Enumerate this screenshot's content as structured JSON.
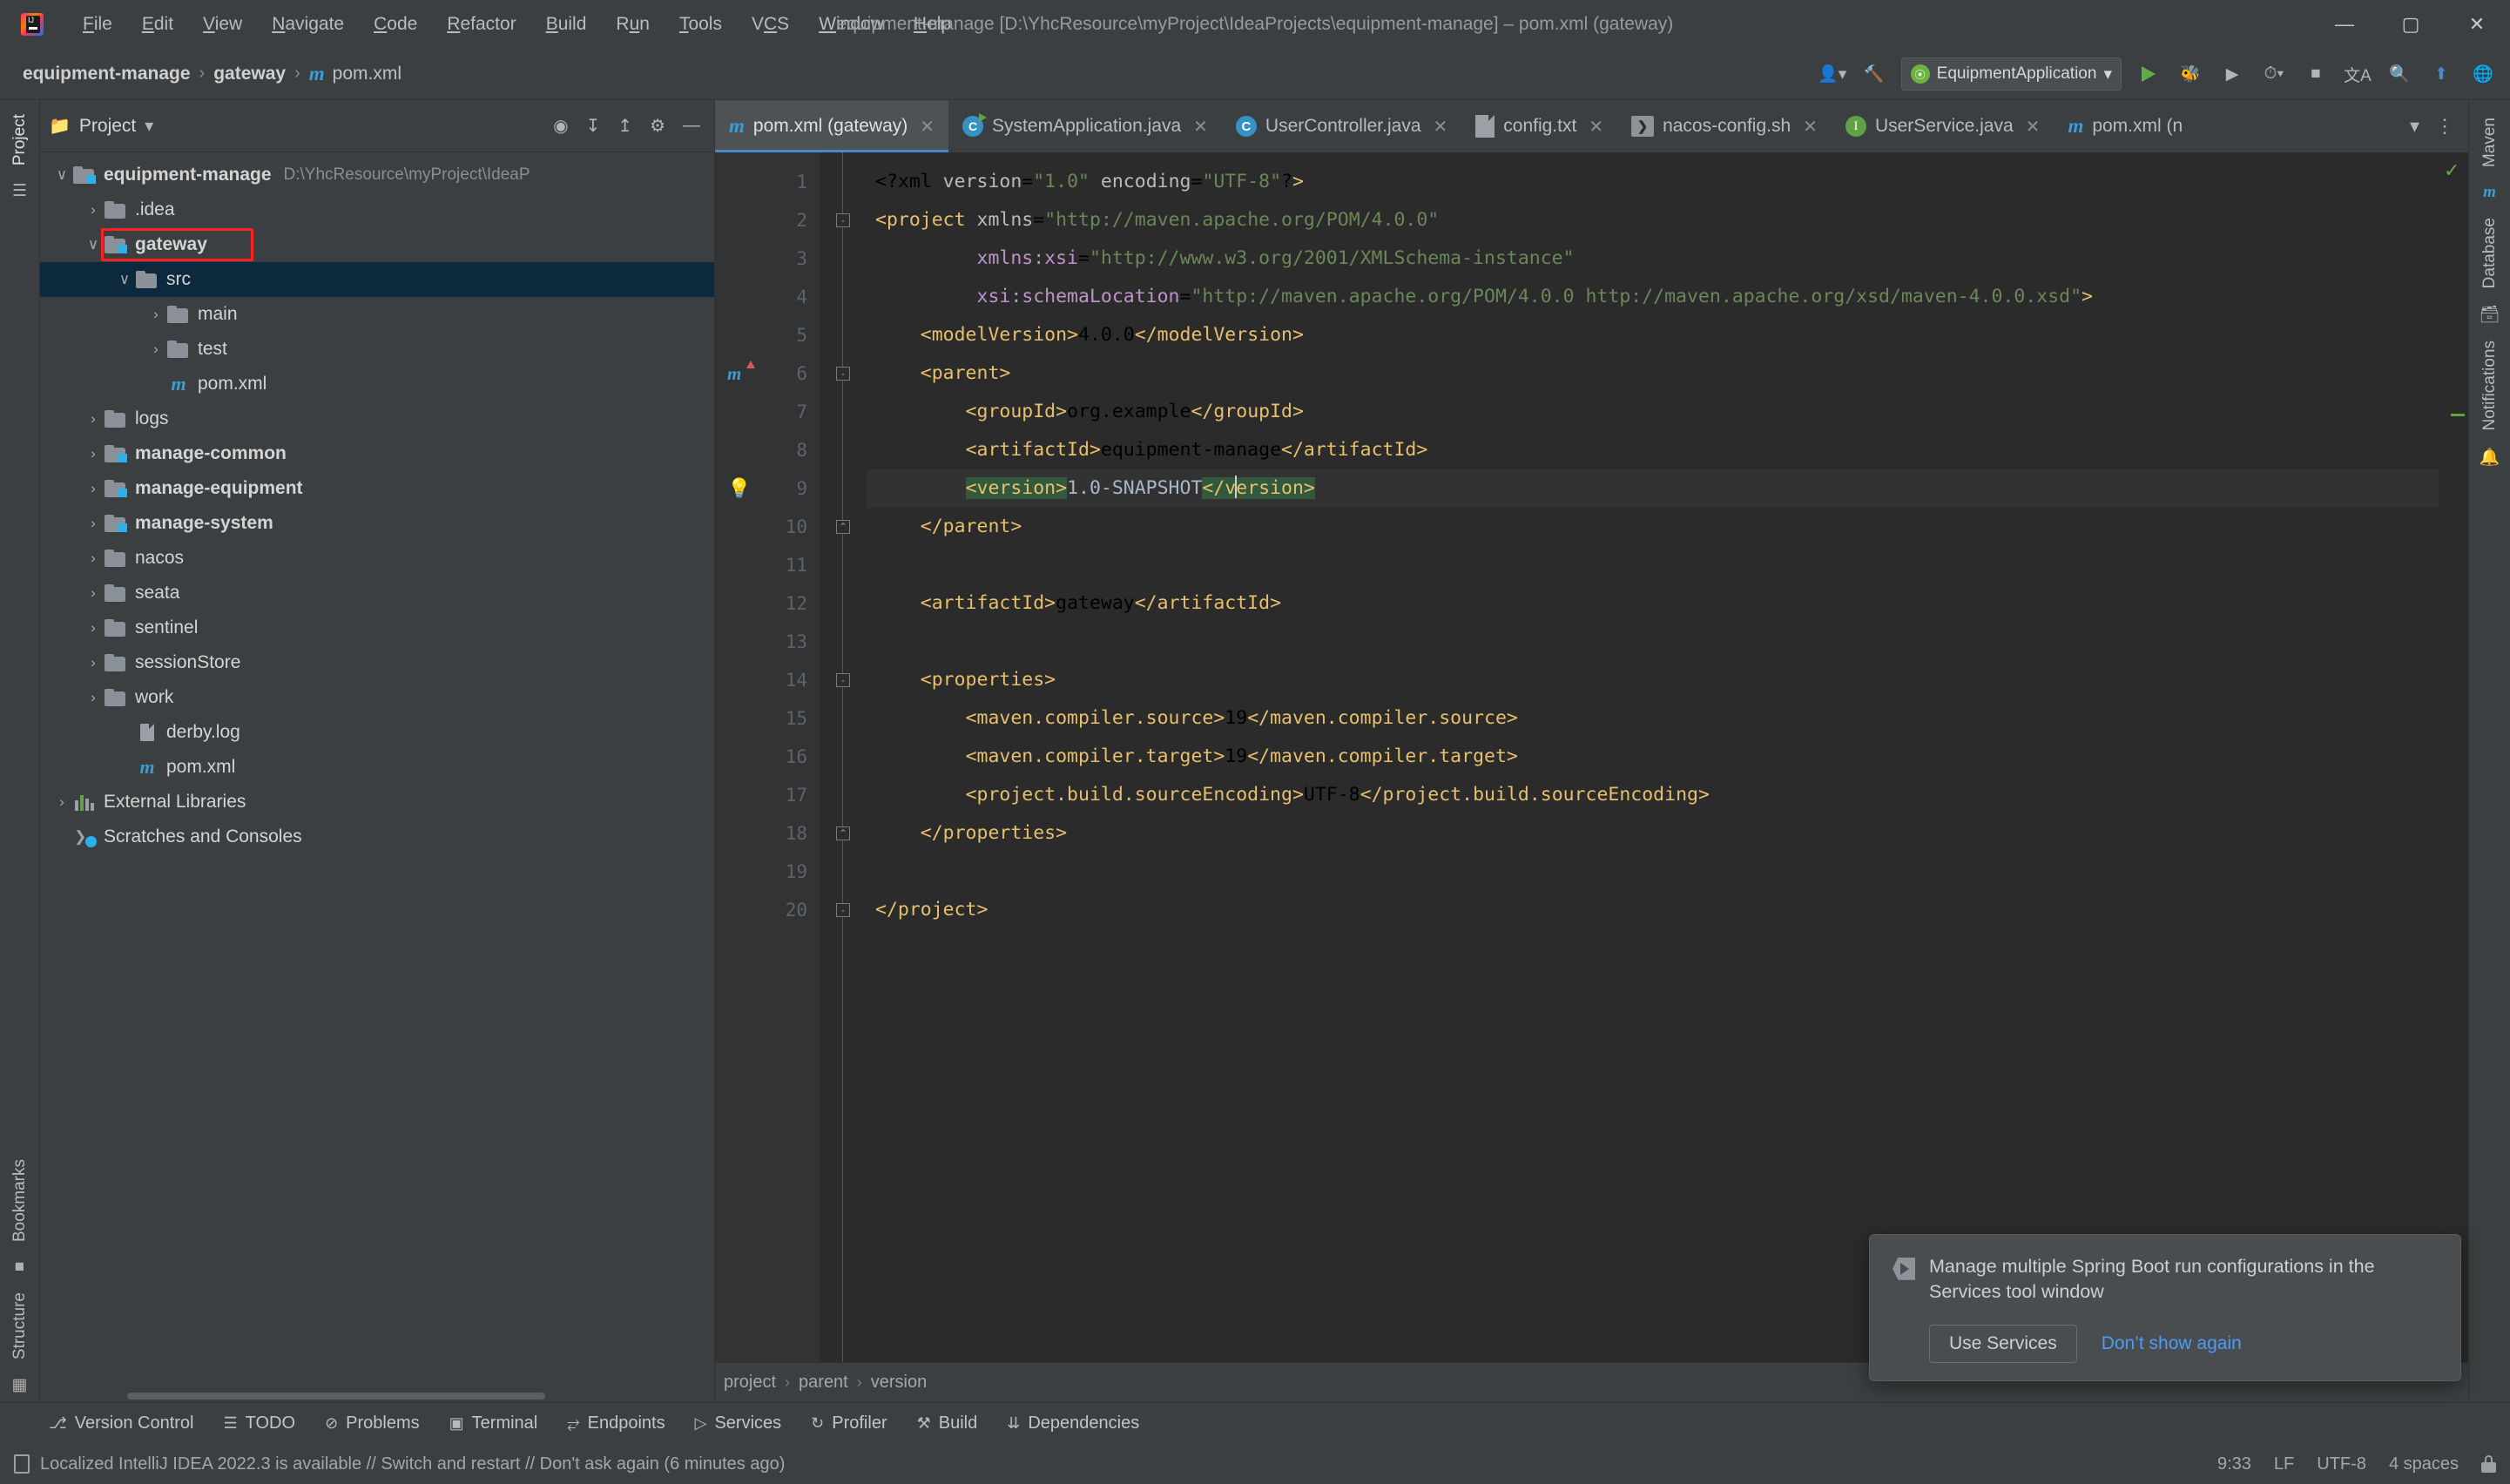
{
  "window": {
    "title": "equipment-manage [D:\\YhcResource\\myProject\\IdeaProjects\\equipment-manage] – pom.xml (gateway)",
    "minimize": "—",
    "maximize": "▢",
    "close": "✕"
  },
  "menubar": [
    {
      "label": "File",
      "mnemonic": "F"
    },
    {
      "label": "Edit",
      "mnemonic": "E"
    },
    {
      "label": "View",
      "mnemonic": "V"
    },
    {
      "label": "Navigate",
      "mnemonic": "N"
    },
    {
      "label": "Code",
      "mnemonic": "C"
    },
    {
      "label": "Refactor",
      "mnemonic": "R"
    },
    {
      "label": "Build",
      "mnemonic": "B"
    },
    {
      "label": "Run",
      "mnemonic": "u"
    },
    {
      "label": "Tools",
      "mnemonic": "T"
    },
    {
      "label": "VCS",
      "mnemonic": "S"
    },
    {
      "label": "Window",
      "mnemonic": "W"
    },
    {
      "label": "Help",
      "mnemonic": "H"
    }
  ],
  "navbar": {
    "breadcrumbs": [
      "equipment-manage",
      "gateway",
      "pom.xml"
    ],
    "separator": "›",
    "run_configuration": "EquipmentApplication",
    "run_config_caret": "▾"
  },
  "project_panel": {
    "title": "Project",
    "caret": "▾",
    "icons": [
      "locate-icon",
      "expand-all-icon",
      "collapse-all-icon",
      "settings-icon",
      "hide-icon"
    ],
    "tree": [
      {
        "label": "equipment-manage",
        "sub": "D:\\YhcResource\\myProject\\IdeaP",
        "depth": 0,
        "arrow": "∨",
        "kind": "module",
        "bold": true,
        "selected": false
      },
      {
        "label": ".idea",
        "depth": 1,
        "arrow": "›",
        "kind": "folder",
        "bold": false,
        "selected": false
      },
      {
        "label": "gateway",
        "depth": 1,
        "arrow": "∨",
        "kind": "module",
        "bold": true,
        "selected": false,
        "highlighted": true
      },
      {
        "label": "src",
        "depth": 2,
        "arrow": "∨",
        "kind": "folder",
        "bold": false,
        "selected": true
      },
      {
        "label": "main",
        "depth": 3,
        "arrow": "›",
        "kind": "folder",
        "bold": false,
        "selected": false
      },
      {
        "label": "test",
        "depth": 3,
        "arrow": "›",
        "kind": "folder",
        "bold": false,
        "selected": false
      },
      {
        "label": "pom.xml",
        "depth": 3,
        "arrow": "",
        "kind": "maven",
        "bold": false,
        "selected": false
      },
      {
        "label": "logs",
        "depth": 1,
        "arrow": "›",
        "kind": "folder",
        "bold": false,
        "selected": false
      },
      {
        "label": "manage-common",
        "depth": 1,
        "arrow": "›",
        "kind": "module",
        "bold": true,
        "selected": false
      },
      {
        "label": "manage-equipment",
        "depth": 1,
        "arrow": "›",
        "kind": "module",
        "bold": true,
        "selected": false
      },
      {
        "label": "manage-system",
        "depth": 1,
        "arrow": "›",
        "kind": "module",
        "bold": true,
        "selected": false
      },
      {
        "label": "nacos",
        "depth": 1,
        "arrow": "›",
        "kind": "folder",
        "bold": false,
        "selected": false
      },
      {
        "label": "seata",
        "depth": 1,
        "arrow": "›",
        "kind": "folder",
        "bold": false,
        "selected": false
      },
      {
        "label": "sentinel",
        "depth": 1,
        "arrow": "›",
        "kind": "folder",
        "bold": false,
        "selected": false
      },
      {
        "label": "sessionStore",
        "depth": 1,
        "arrow": "›",
        "kind": "folder",
        "bold": false,
        "selected": false
      },
      {
        "label": "work",
        "depth": 1,
        "arrow": "›",
        "kind": "folder",
        "bold": false,
        "selected": false
      },
      {
        "label": "derby.log",
        "depth": 2,
        "arrow": "",
        "kind": "doc",
        "bold": false,
        "selected": false
      },
      {
        "label": "pom.xml",
        "depth": 2,
        "arrow": "",
        "kind": "maven",
        "bold": false,
        "selected": false
      },
      {
        "label": "External Libraries",
        "depth": 0,
        "arrow": "›",
        "kind": "library",
        "bold": false,
        "selected": false
      },
      {
        "label": "Scratches and Consoles",
        "depth": 0,
        "arrow": "",
        "kind": "scratch",
        "bold": false,
        "selected": false
      }
    ]
  },
  "left_rail": {
    "top": [
      "Project"
    ],
    "bottom": [
      "Bookmarks",
      "Structure"
    ]
  },
  "right_rail": {
    "items": [
      "Maven",
      "Database",
      "Notifications"
    ]
  },
  "editor_tabs": [
    {
      "label": "pom.xml (gateway)",
      "icon": "maven-icon",
      "active": true,
      "close": "✕"
    },
    {
      "label": "SystemApplication.java",
      "icon": "spring-boot-class-icon",
      "active": false,
      "close": "✕"
    },
    {
      "label": "UserController.java",
      "icon": "java-class-icon",
      "active": false,
      "close": "✕"
    },
    {
      "label": "config.txt",
      "icon": "text-file-icon",
      "active": false,
      "close": "✕"
    },
    {
      "label": "nacos-config.sh",
      "icon": "shell-script-icon",
      "active": false,
      "close": "✕"
    },
    {
      "label": "UserService.java",
      "icon": "java-interface-icon",
      "active": false,
      "close": "✕"
    },
    {
      "label": "pom.xml (n",
      "icon": "maven-icon",
      "active": false,
      "close": ""
    }
  ],
  "editor": {
    "line_numbers": [
      1,
      2,
      3,
      4,
      5,
      6,
      7,
      8,
      9,
      10,
      11,
      12,
      13,
      14,
      15,
      16,
      17,
      18,
      19,
      20
    ],
    "lines": [
      "<?xml version=\"1.0\" encoding=\"UTF-8\"?>",
      "<project xmlns=\"http://maven.apache.org/POM/4.0.0\"",
      "         xmlns:xsi=\"http://www.w3.org/2001/XMLSchema-instance\"",
      "         xsi:schemaLocation=\"http://maven.apache.org/POM/4.0.0 http://maven.apache.org/xsd/maven-4.0.0.xsd\">",
      "    <modelVersion>4.0.0</modelVersion>",
      "    <parent>",
      "        <groupId>org.example</groupId>",
      "        <artifactId>equipment-manage</artifactId>",
      "        <version>1.0-SNAPSHOT</version>",
      "    </parent>",
      "",
      "    <artifactId>gateway</artifactId>",
      "",
      "    <properties>",
      "        <maven.compiler.source>19</maven.compiler.source>",
      "        <maven.compiler.target>19</maven.compiler.target>",
      "        <project.build.sourceEncoding>UTF-8</project.build.sourceEncoding>",
      "    </properties>",
      "",
      "</project>"
    ],
    "caret_line": 9,
    "bulb_line": 9,
    "maven_marker_line": 6,
    "inspection_status": "✓"
  },
  "editor_footer": {
    "crumbs": [
      "project",
      "parent",
      "version"
    ],
    "separator": "›"
  },
  "notification": {
    "message": "Manage multiple Spring Boot run configurations in the Services tool window",
    "primary_button": "Use Services",
    "secondary_link": "Don’t show again"
  },
  "tool_window_bar": [
    {
      "label": "Version Control",
      "icon": "branch-icon"
    },
    {
      "label": "TODO",
      "icon": "list-icon"
    },
    {
      "label": "Problems",
      "icon": "error-icon"
    },
    {
      "label": "Terminal",
      "icon": "terminal-icon"
    },
    {
      "label": "Endpoints",
      "icon": "endpoints-icon"
    },
    {
      "label": "Services",
      "icon": "services-icon"
    },
    {
      "label": "Profiler",
      "icon": "profiler-icon"
    },
    {
      "label": "Build",
      "icon": "hammer-icon"
    },
    {
      "label": "Dependencies",
      "icon": "dependencies-icon"
    }
  ],
  "statusbar": {
    "message": "Localized IntelliJ IDEA 2022.3 is available // Switch and restart // Don't ask again (6 minutes ago)",
    "caret_position": "9:33",
    "line_separator": "LF",
    "encoding": "UTF-8",
    "indent": "4 spaces",
    "lock": "read-write-lock-icon"
  },
  "colors": {
    "accent": "#4a88c7",
    "chrome": "#3c3f41",
    "editor_bg": "#2b2b2b",
    "selection": "#0d293e",
    "highlight_box": "#ff2020",
    "tag": "#e8bf6a",
    "string": "#6a8759",
    "ns": "#bd93c9"
  }
}
